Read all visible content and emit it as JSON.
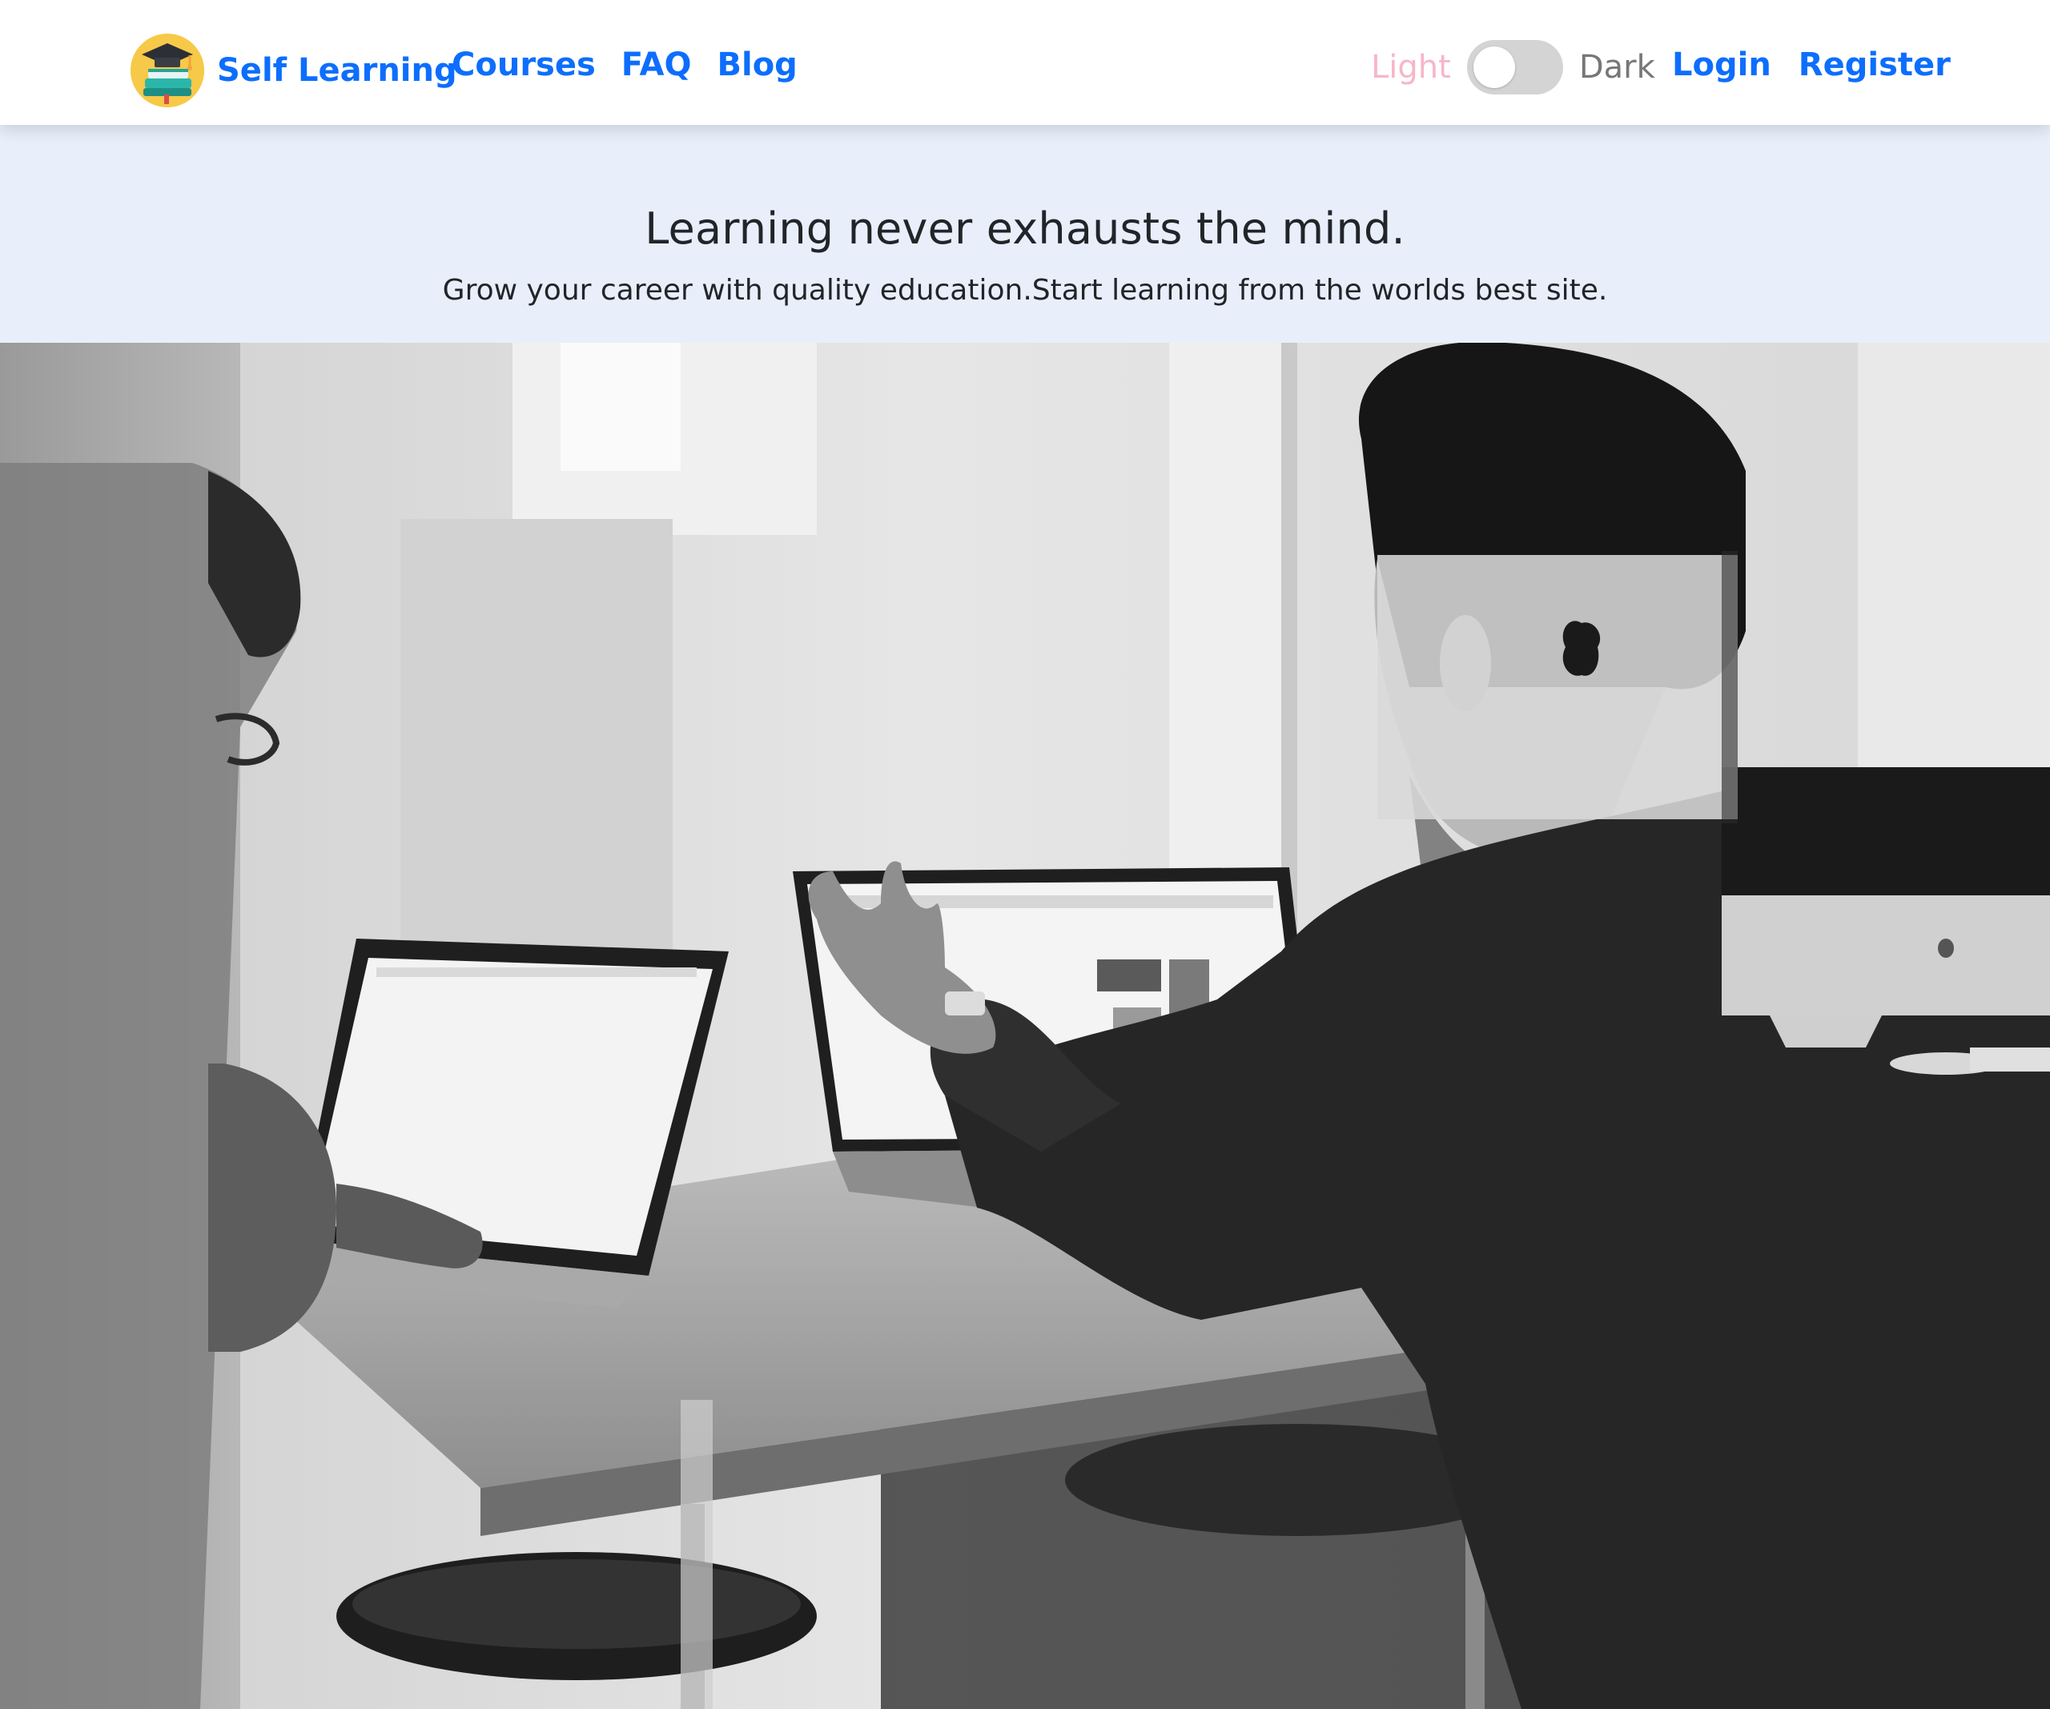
{
  "navbar": {
    "brand_name": "Self Learning",
    "links": [
      "Courses",
      "FAQ",
      "Blog"
    ],
    "theme_toggle": {
      "light_label": "Light",
      "dark_label": "Dark",
      "state": "light"
    },
    "auth": {
      "login_label": "Login",
      "register_label": "Register"
    }
  },
  "hero": {
    "title": "Learning never exhausts the mind.",
    "subtitle": "Grow your career with quality education.Start learning from the worlds best site."
  },
  "colors": {
    "brand_blue": "#0d6efd",
    "hero_background": "#e8effb",
    "light_label": "#f7b6c8",
    "logo_yellow": "#f7c948"
  },
  "icons": {
    "logo": "graduation-cap-books-icon"
  }
}
